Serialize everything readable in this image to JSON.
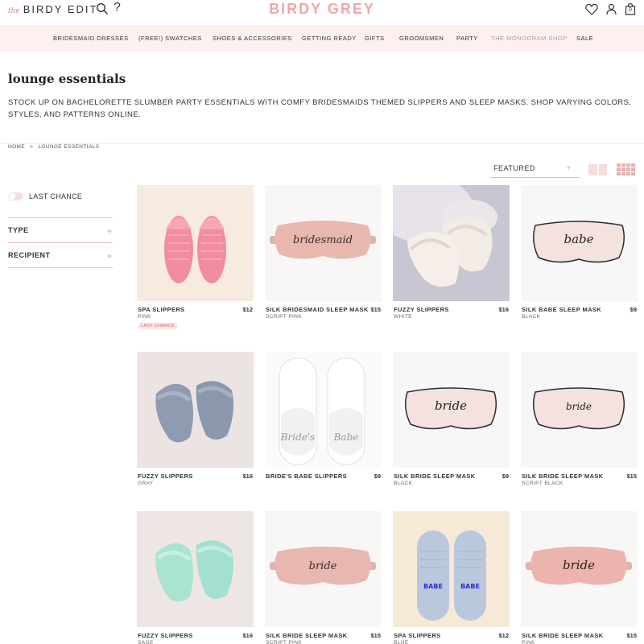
{
  "header": {
    "edit_prefix": "the",
    "edit_name": "BIRDY EDIT",
    "help": "?",
    "brand": "BIRDY GREY",
    "bag_count": "0"
  },
  "icons": {
    "search": "search-icon",
    "help": "question-icon",
    "wishlist": "heart-icon",
    "account": "user-icon",
    "bag": "shopping-bag-icon"
  },
  "nav": [
    "BRIDESMAID DRESSES",
    "(FREE!) SWATCHES",
    "SHOES & ACCESSORIES",
    "GETTING READY",
    "GIFTS",
    "GROOMSMEN",
    "PARTY",
    "THE MONOGRAM SHOP",
    "SALE"
  ],
  "page": {
    "title": "lounge essentials",
    "description": "STOCK UP ON BACHELORETTE SLUMBER PARTY ESSENTIALS WITH COMFY BRIDESMAIDS THEMED SLIPPERS AND SLEEP MASKS. SHOP VARYING COLORS, STYLES, AND PATTERNS ONLINE.",
    "breadcrumb": [
      "HOME",
      ">",
      "LOUNGE ESSENTIALS"
    ]
  },
  "sort": {
    "label": "FEATURED",
    "plus": "+"
  },
  "filters": {
    "toggle_label": "LAST CHANCE",
    "items": [
      {
        "label": "TYPE",
        "plus": "+"
      },
      {
        "label": "RECIPIENT",
        "plus": "+"
      }
    ]
  },
  "products": [
    {
      "name": "SPA SLIPPERS",
      "price": "$12",
      "variant": "PINK",
      "badge": "LAST CHANCE"
    },
    {
      "name": "SILK BRIDESMAID SLEEP MASK",
      "price": "$15",
      "variant": "SCRIPT PINK",
      "mask_text": "bridesmaid"
    },
    {
      "name": "FUZZY SLIPPERS",
      "price": "$16",
      "variant": "WHITE"
    },
    {
      "name": "SILK BABE SLEEP MASK",
      "price": "$9",
      "variant": "BLACK",
      "mask_text": "babe"
    },
    {
      "name": "FUZZY SLIPPERS",
      "price": "$16",
      "variant": "GRAY"
    },
    {
      "name": "BRIDE'S BABE SLIPPERS",
      "price": "$9",
      "variant": "",
      "slipper_text_left": "Bride's",
      "slipper_text_right": "Babe"
    },
    {
      "name": "SILK BRIDE SLEEP MASK",
      "price": "$9",
      "variant": "BLACK",
      "mask_text": "bride"
    },
    {
      "name": "SILK BRIDE SLEEP MASK",
      "price": "$15",
      "variant": "SCRIPT BLACK",
      "mask_text": "bride"
    },
    {
      "name": "FUZZY SLIPPERS",
      "price": "$16",
      "variant": "SAGE"
    },
    {
      "name": "SILK BRIDE SLEEP MASK",
      "price": "$15",
      "variant": "SCRIPT PINK",
      "mask_text": "bride"
    },
    {
      "name": "SPA SLIPPERS",
      "price": "$12",
      "variant": "BLUE",
      "slipper_text_left": "BABE",
      "slipper_text_right": "BABE"
    },
    {
      "name": "SILK BRIDE SLEEP MASK",
      "price": "$15",
      "variant": "PINK",
      "mask_text": "bride"
    }
  ],
  "colors": {
    "brand_pink": "#efa7a7",
    "nav_bg": "#fdf1ef",
    "accent_line": "#f0c3c3"
  }
}
